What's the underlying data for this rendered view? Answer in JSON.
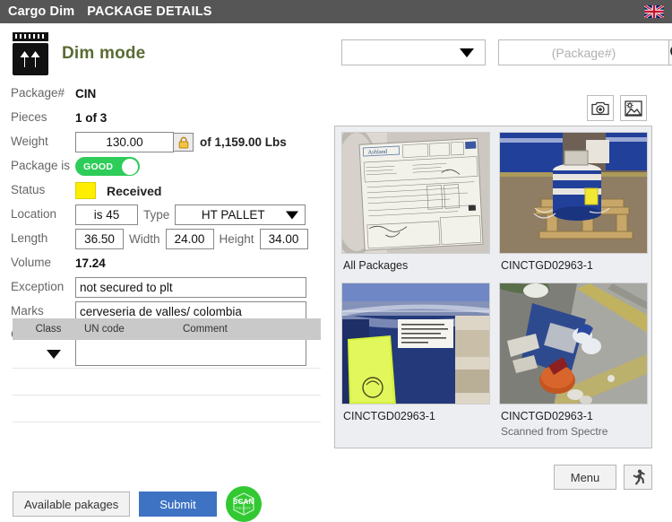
{
  "titlebar": {
    "app_name": "Cargo Dim",
    "page_title": "PACKAGE DETAILS",
    "flag_icon": "uk-flag-icon"
  },
  "mode": {
    "icon": "dim-mode-icon",
    "title": "Dim mode"
  },
  "form": {
    "package_label": "Package#",
    "package_value": "CIN",
    "pieces_label": "Pieces",
    "pieces_value": "1 of 3",
    "weight_label": "Weight",
    "weight_value": "130.00",
    "weight_lock_icon": "lock-closed-icon",
    "weight_total": "of 1,159.00 Lbs",
    "package_is_label": "Package is",
    "package_is_value": "GOOD",
    "status_label": "Status",
    "status_value": "Received",
    "status_color": "#ffee00",
    "location_label": "Location",
    "location_value": "is 45",
    "type_label": "Type",
    "type_value": "HT PALLET",
    "length_label": "Length",
    "length_value": "36.50",
    "width_label": "Width",
    "width_value": "24.00",
    "height_label": "Height",
    "height_value": "34.00",
    "volume_label": "Volume",
    "volume_value": "17.24",
    "exception_label": "Exception",
    "exception_value": "not secured to plt",
    "marks_label": "Marks",
    "marks_value": "cerveseria de valles/ colombia",
    "comments_label": "Comments",
    "comments_value": ""
  },
  "dg_table": {
    "columns": [
      "Class",
      "UN code",
      "Comment"
    ],
    "rows": [
      {
        "class": "",
        "un_code": "",
        "comment": ""
      },
      {
        "class": "",
        "un_code": "",
        "comment": ""
      }
    ]
  },
  "bottom_bar": {
    "available_packages_label": "Available pakages",
    "submit_label": "Submit",
    "scan_label": "SCAN",
    "scan_sub_label": "READY",
    "menu_label": "Menu",
    "run_icon": "running-person-icon"
  },
  "toolbar": {
    "filter_select_value": "",
    "search_placeholder": "(Package#)",
    "search_value": "",
    "search_icon": "search-icon",
    "camera_icon": "camera-icon",
    "gallery_icon": "image-icon"
  },
  "gallery": {
    "items": [
      {
        "caption": "All Packages",
        "sub": "",
        "image": "shipping-document-photo"
      },
      {
        "caption": "CINCTGD02963-1",
        "sub": "",
        "image": "blue-drum-on-pallet-photo"
      },
      {
        "caption": "CINCTGD02963-1",
        "sub": "",
        "image": "labeled-blue-drum-photo"
      },
      {
        "caption": "CINCTGD02963-1",
        "sub": "Scanned from Spectre",
        "image": "warehouse-overhead-photo"
      }
    ]
  },
  "colors": {
    "header_bg": "#565656",
    "accent_green": "#5b6b33",
    "toggle_green": "#2ecc58",
    "submit_blue": "#3e73c4",
    "scan_green": "#32c832",
    "status_yellow": "#ffee00"
  }
}
